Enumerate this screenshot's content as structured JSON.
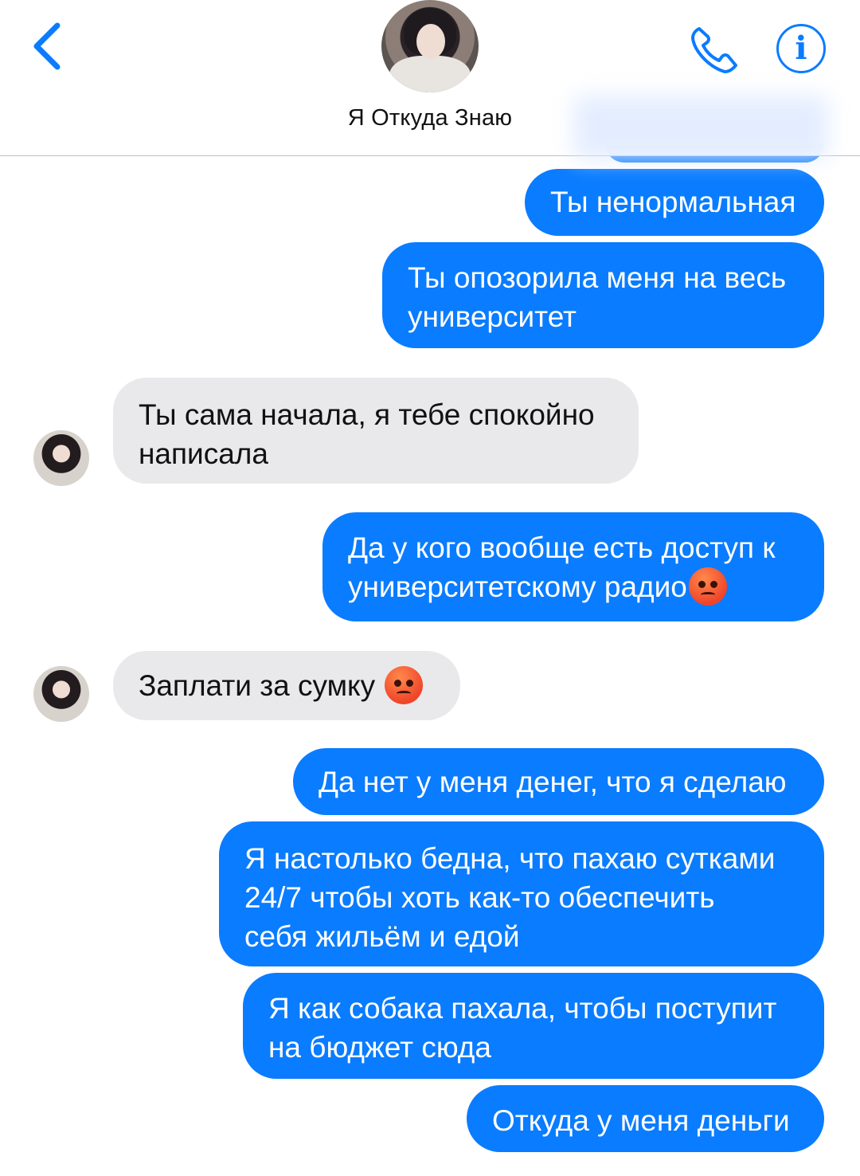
{
  "header": {
    "contact_name": "Я Откуда Знаю",
    "back_icon": "chevron-left-icon",
    "call_icon": "phone-icon",
    "info_icon": "info-icon",
    "info_glyph": "i",
    "accent_color": "#0a7cff"
  },
  "messages": [
    {
      "direction": "sent",
      "text": "Ты ненормальная"
    },
    {
      "direction": "sent",
      "lines": [
        "Ты опозорила меня на весь",
        "университет"
      ]
    },
    {
      "direction": "received",
      "lines": [
        "Ты сама начала, я тебе спокойно",
        "написала"
      ]
    },
    {
      "direction": "sent",
      "lines": [
        "Да у кого вообще есть доступ к",
        "университетскому радио"
      ],
      "emoji": "pouting-face-emoji"
    },
    {
      "direction": "received",
      "text": "Заплати за сумку ",
      "emoji": "pouting-face-emoji"
    },
    {
      "direction": "sent",
      "text": "Да нет у меня денег, что я сделаю"
    },
    {
      "direction": "sent",
      "lines": [
        "Я настолько бедна, что пахаю сутками",
        "24/7 чтобы хоть как-то обеспечить",
        "себя жильём и едой"
      ]
    },
    {
      "direction": "sent",
      "lines": [
        "Я как собака пахала, чтобы поступит",
        "на бюджет сюда"
      ]
    },
    {
      "direction": "sent",
      "text": "Откуда у меня деньги"
    }
  ],
  "colors": {
    "sent_bubble": "#0a7cff",
    "received_bubble": "#e9e9eb"
  }
}
